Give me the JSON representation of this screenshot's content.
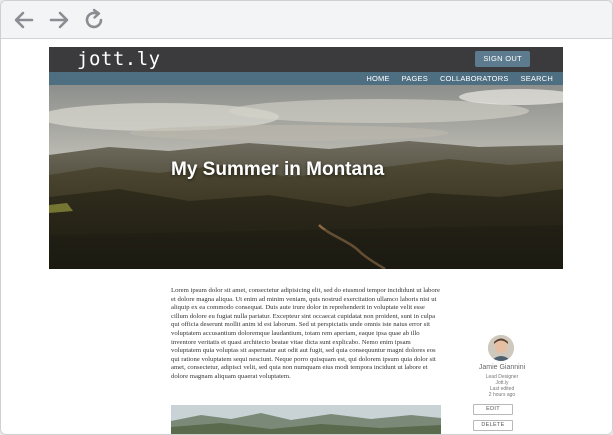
{
  "site": {
    "logo": "jott.ly",
    "signout_label": "SIGN OUT",
    "nav": [
      "HOME",
      "PAGES",
      "COLLABORATORS",
      "SEARCH"
    ]
  },
  "post": {
    "title": "My Summer in Montana",
    "body": "Lorem ipsum dolor sit amet, consectetur adipisicing elit, sed do eiusmod tempor incididunt ut labore et dolore magna aliqua. Ut enim ad minim veniam, quis nostrud exercitation ullamco laboris nisi ut aliquip ex ea commodo consequat. Duis aute irure dolor in reprehenderit in voluptate velit esse cillum dolore eu fugiat nulla pariatur. Excepteur sint occaecat cupidatat non proident, sunt in culpa qui officia deserunt mollit anim id est laborum. Sed ut perspiciatis unde omnis iste natus error sit voluptatem accusantium doloremque laudantium, totam rem aperiam, eaque ipsa quae ab illo inventore veritatis et quasi architecto beatae vitae dicta sunt explicabo. Nemo enim ipsam voluptatem quia voluptas sit aspernatur aut odit aut fugit, sed quia consequuntur magni dolores eos qui ratione voluptatem sequi nesciunt. Neque porro quisquam est, qui dolorem ipsum quia dolor sit amet, consectetur, adipisci velit, sed quia non numquam eius modi tempora incidunt ut labore et dolore magnam aliquam quaerat voluptatem."
  },
  "author": {
    "name": "Jamie Giannini",
    "role": "Lead Designer",
    "company": "Jott.ly",
    "edited_label": "Last edited",
    "edited_time": "2 hours ago"
  },
  "actions": {
    "edit_label": "EDIT",
    "delete_label": "DELETE"
  },
  "colors": {
    "header": "#3b3b3d",
    "nav_bar": "#4e6e82",
    "signout": "#5d7b8e"
  },
  "icons": [
    "arrow-left-icon",
    "arrow-right-icon",
    "reload-icon"
  ]
}
